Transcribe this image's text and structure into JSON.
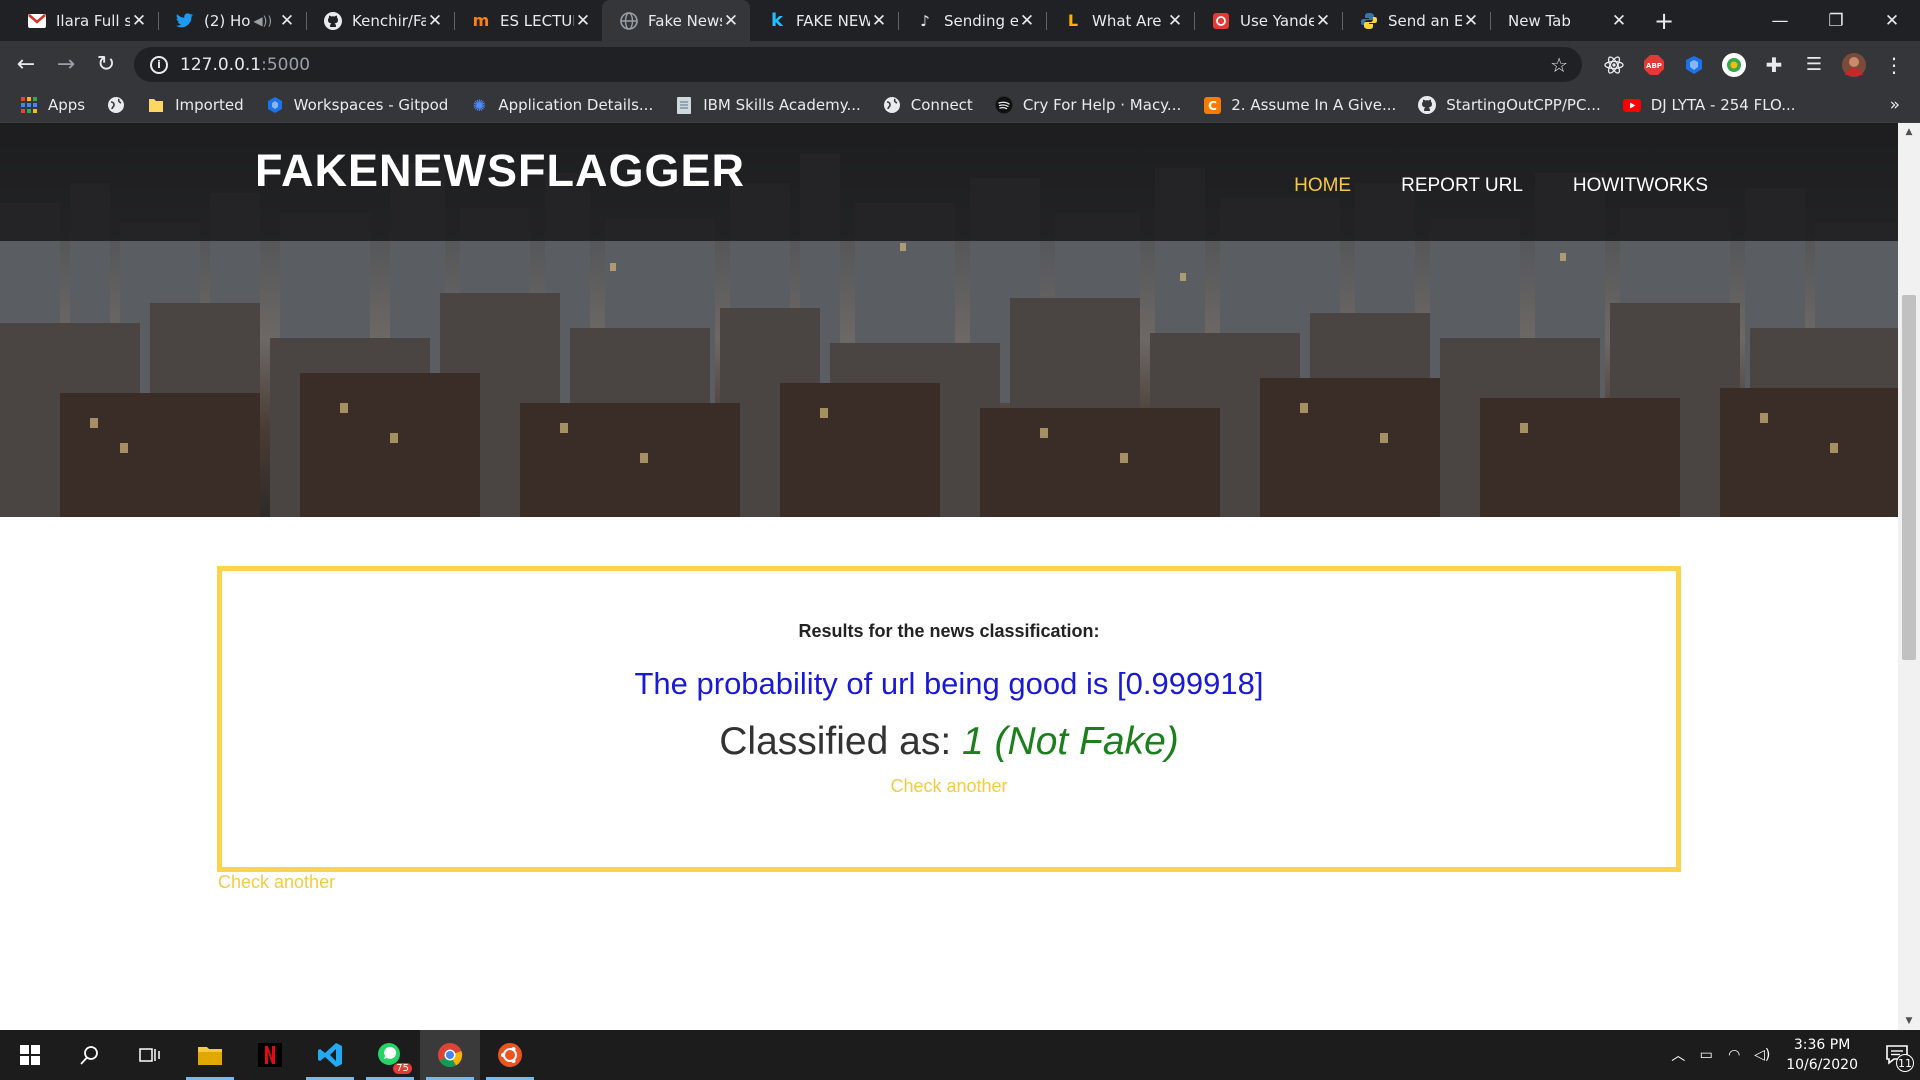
{
  "browser": {
    "tabs": [
      {
        "title": "Ilara Full s",
        "icon": "gmail-icon",
        "audio": false,
        "active": false
      },
      {
        "title": "(2) Ho",
        "icon": "twitter-icon",
        "audio": true,
        "active": false
      },
      {
        "title": "Kenchir/Fa",
        "icon": "github-icon",
        "audio": false,
        "active": false
      },
      {
        "title": "ES LECTUR",
        "icon": "moodle-icon",
        "audio": false,
        "active": false
      },
      {
        "title": "Fake News",
        "icon": "globe-icon",
        "audio": false,
        "active": true
      },
      {
        "title": "FAKE NEW",
        "icon": "kaggle-icon",
        "audio": false,
        "active": false
      },
      {
        "title": "Sending e",
        "icon": "blog-icon",
        "audio": false,
        "active": false
      },
      {
        "title": "What Are",
        "icon": "bookmark-l-icon",
        "audio": false,
        "active": false
      },
      {
        "title": "Use Yande",
        "icon": "yandex-icon",
        "audio": false,
        "active": false
      },
      {
        "title": "Send an E",
        "icon": "python-icon",
        "audio": false,
        "active": false
      },
      {
        "title": "New Tab",
        "icon": "",
        "audio": false,
        "active": false
      }
    ],
    "address": {
      "host": "127.0.0.1",
      "port": ":5000"
    },
    "bookmarks": [
      {
        "label": "Apps",
        "icon": "apps-grid-icon"
      },
      {
        "label": "",
        "icon": "globe-icon"
      },
      {
        "label": "Imported",
        "icon": "folder-icon"
      },
      {
        "label": "Workspaces - Gitpod",
        "icon": "gitpod-icon"
      },
      {
        "label": "Application Details...",
        "icon": "ibm-icon"
      },
      {
        "label": "IBM Skills Academy...",
        "icon": "document-icon"
      },
      {
        "label": "Connect",
        "icon": "globe-icon"
      },
      {
        "label": "Cry For Help · Macy...",
        "icon": "spotify-icon"
      },
      {
        "label": "2. Assume In A Give...",
        "icon": "coursera-icon"
      },
      {
        "label": "StartingOutCPP/PC...",
        "icon": "github-icon"
      },
      {
        "label": "DJ LYTA - 254 FLO...",
        "icon": "youtube-icon"
      }
    ],
    "more_label": "»"
  },
  "site": {
    "logo": "FAKENEWSFLAGGER",
    "nav": [
      {
        "label": "HOME",
        "active": true
      },
      {
        "label": "REPORT URL",
        "active": false
      },
      {
        "label": "HOWITWORKS",
        "active": false
      }
    ]
  },
  "result": {
    "heading": "Results for the news classification:",
    "probability_text": "The probability of url being good is [0.999918]",
    "classified_label": "Classified as:",
    "classified_value": "1 (Not Fake)",
    "check_inside": "Check another",
    "check_outside": "Check another"
  },
  "taskbar": {
    "time": "3:36 PM",
    "date": "10/6/2020",
    "whatsapp_badge": "75",
    "notifications": "11"
  },
  "colors": {
    "accent_yellow": "#f6c945",
    "box_border": "#fbd34d",
    "probability_blue": "#1a1ad6",
    "classification_green": "#1b7f1b"
  }
}
